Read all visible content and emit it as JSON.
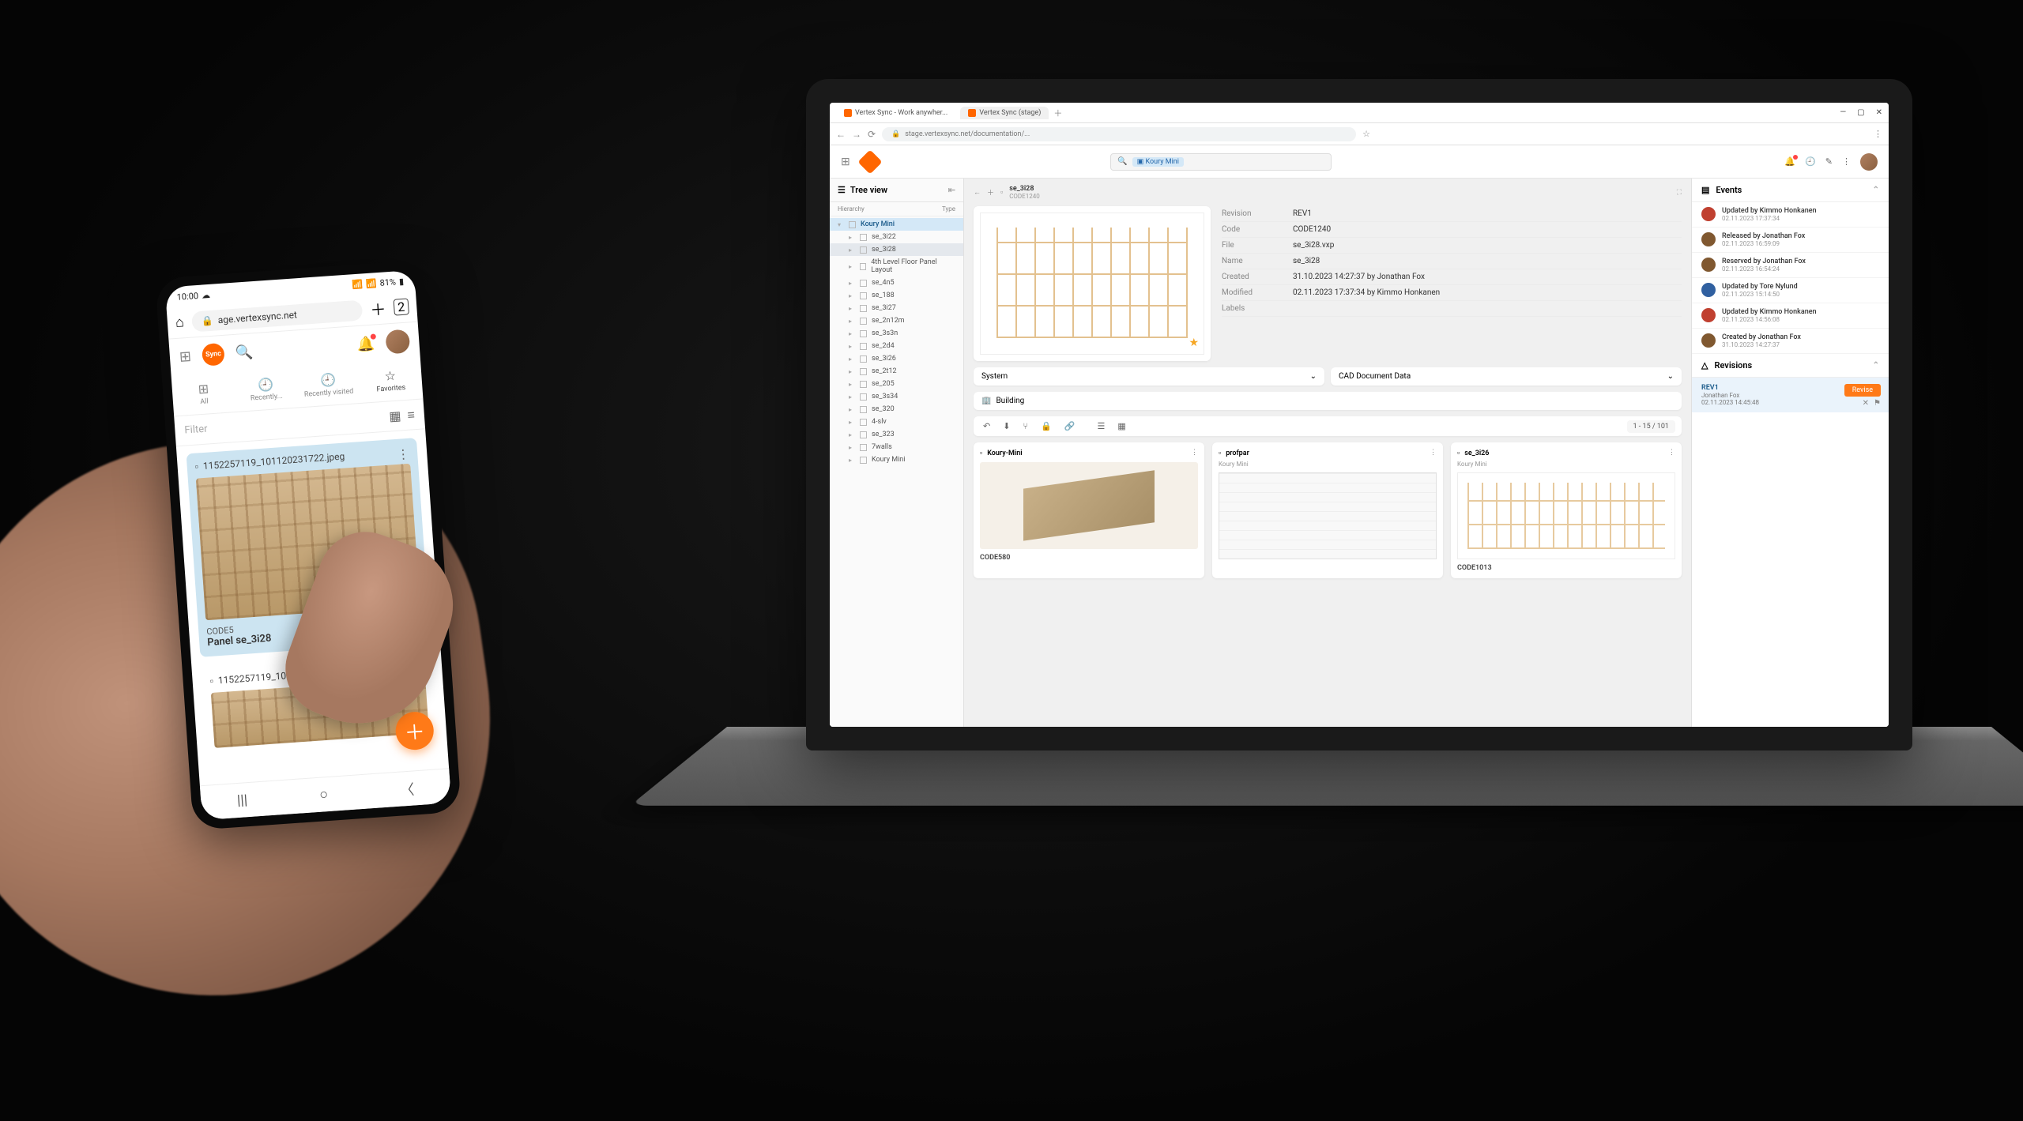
{
  "browser": {
    "tabs": [
      {
        "title": "Vertex Sync - Work anywher..."
      },
      {
        "title": "Vertex Sync (stage)"
      }
    ],
    "url": "stage.vertexsync.net/documentation/..."
  },
  "app_header": {
    "search_chip": "Koury Mini"
  },
  "tree": {
    "title": "Tree view",
    "col1": "Hierarchy",
    "col2": "Type",
    "items": [
      {
        "label": "Koury Mini",
        "active": true,
        "expanded": true
      },
      {
        "label": "se_3i22",
        "indent": 1
      },
      {
        "label": "se_3i28",
        "indent": 1,
        "selected": true
      },
      {
        "label": "4th Level Floor Panel Layout",
        "indent": 1
      },
      {
        "label": "se_4n5",
        "indent": 1
      },
      {
        "label": "se_188",
        "indent": 1
      },
      {
        "label": "se_3i27",
        "indent": 1
      },
      {
        "label": "se_2n12m",
        "indent": 1
      },
      {
        "label": "se_3s3n",
        "indent": 1
      },
      {
        "label": "se_2d4",
        "indent": 1
      },
      {
        "label": "se_3i26",
        "indent": 1
      },
      {
        "label": "se_2t12",
        "indent": 1
      },
      {
        "label": "se_205",
        "indent": 1
      },
      {
        "label": "se_3s34",
        "indent": 1
      },
      {
        "label": "se_320",
        "indent": 1
      },
      {
        "label": "4-slv",
        "indent": 1
      },
      {
        "label": "se_323",
        "indent": 1
      },
      {
        "label": "7walls",
        "indent": 1
      },
      {
        "label": "Koury Mini",
        "indent": 1
      }
    ]
  },
  "breadcrumb": {
    "name": "se_3i28",
    "code": "CODE1240"
  },
  "meta": {
    "rows": [
      {
        "k": "Revision",
        "v": "REV1"
      },
      {
        "k": "Code",
        "v": "CODE1240"
      },
      {
        "k": "File",
        "v": "se_3i28.vxp"
      },
      {
        "k": "Name",
        "v": "se_3i28"
      },
      {
        "k": "Created",
        "v": "31.10.2023 14:27:37 by Jonathan Fox"
      },
      {
        "k": "Modified",
        "v": "02.11.2023 17:37:34 by Kimmo Honkanen"
      },
      {
        "k": "Labels",
        "v": ""
      }
    ]
  },
  "sections": {
    "system": "System",
    "caddoc": "CAD Document Data",
    "building": "Building"
  },
  "pager": "1 - 15  / 101",
  "cards": [
    {
      "title": "Koury-Mini",
      "sub": "",
      "code": "CODE580",
      "type": "building"
    },
    {
      "title": "profpar",
      "sub": "Koury Mini",
      "code": "",
      "type": "table"
    },
    {
      "title": "se_3i26",
      "sub": "Koury Mini",
      "code": "CODE1013",
      "type": "drawing"
    }
  ],
  "events": {
    "title": "Events",
    "items": [
      {
        "title": "Updated by Kimmo Honkanen",
        "time": "02.11.2023 17:37:34",
        "color": "#c04030"
      },
      {
        "title": "Released by Jonathan Fox",
        "time": "02.11.2023 16:59:09",
        "color": "#805830"
      },
      {
        "title": "Reserved by Jonathan Fox",
        "time": "02.11.2023 16:54:24",
        "color": "#805830"
      },
      {
        "title": "Updated by Tore Nylund",
        "time": "02.11.2023 15:14:50",
        "color": "#3060a0"
      },
      {
        "title": "Updated by Kimmo Honkanen",
        "time": "02.11.2023 14:56:08",
        "color": "#c04030"
      },
      {
        "title": "Created by Jonathan Fox",
        "time": "31.10.2023 14:27:37",
        "color": "#805830"
      }
    ]
  },
  "revisions": {
    "title": "Revisions",
    "item": {
      "name": "REV1",
      "author": "Jonathan Fox",
      "time": "02.11.2023 14:45:48",
      "button": "Revise"
    }
  },
  "phone": {
    "status_time": "10:00",
    "status_batt": "81%",
    "url": "age.vertexsync.net",
    "logo_text": "Sync",
    "tabs": [
      {
        "label": "All",
        "icon": "⊞"
      },
      {
        "label": "Recently...",
        "icon": "🕘"
      },
      {
        "label": "Recently visited",
        "icon": "🕘"
      },
      {
        "label": "Favorites",
        "icon": "☆"
      }
    ],
    "filter_placeholder": "Filter",
    "card1": {
      "filename": "1152257119_101120231722.jpeg",
      "code": "CODE5",
      "name": "Panel se_3i28"
    },
    "card2": {
      "filename": "1152257119_101120231836.jpeg"
    }
  }
}
